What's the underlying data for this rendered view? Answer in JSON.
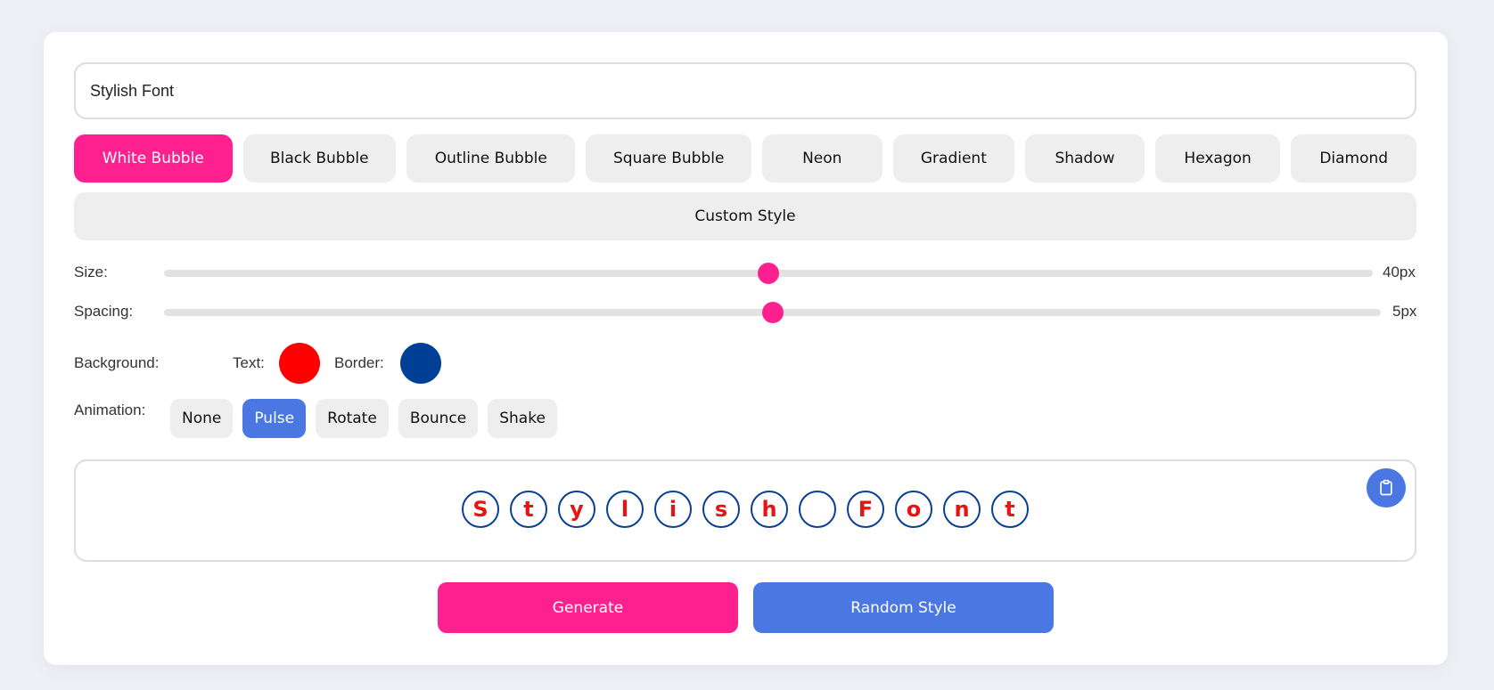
{
  "input": {
    "value": "Stylish Font"
  },
  "styles": {
    "items": [
      "White Bubble",
      "Black Bubble",
      "Outline Bubble",
      "Square Bubble",
      "Neon",
      "Gradient",
      "Shadow",
      "Hexagon",
      "Diamond"
    ],
    "active": "White Bubble",
    "custom_label": "Custom Style"
  },
  "controls": {
    "size": {
      "label": "Size:",
      "value_label": "40px",
      "fraction": 0.5
    },
    "spacing": {
      "label": "Spacing:",
      "value_label": "5px",
      "fraction": 0.5
    },
    "colors": {
      "background_label": "Background:",
      "text_label": "Text:",
      "text_color": "#ff0000",
      "border_label": "Border:",
      "border_color": "#003f96"
    },
    "animation": {
      "label": "Animation:",
      "options": [
        "None",
        "Pulse",
        "Rotate",
        "Bounce",
        "Shake"
      ],
      "active": "Pulse"
    }
  },
  "preview": {
    "letters": [
      "S",
      "t",
      "y",
      "l",
      "i",
      "s",
      "h",
      " ",
      "F",
      "o",
      "n",
      "t"
    ],
    "copy_icon": "clipboard-icon"
  },
  "actions": {
    "generate_label": "Generate",
    "random_label": "Random Style",
    "generate_color": "#ff2090",
    "random_color": "#4a77e2"
  },
  "colors": {
    "accent_pink": "#ff2090",
    "accent_blue": "#4a77e2"
  }
}
